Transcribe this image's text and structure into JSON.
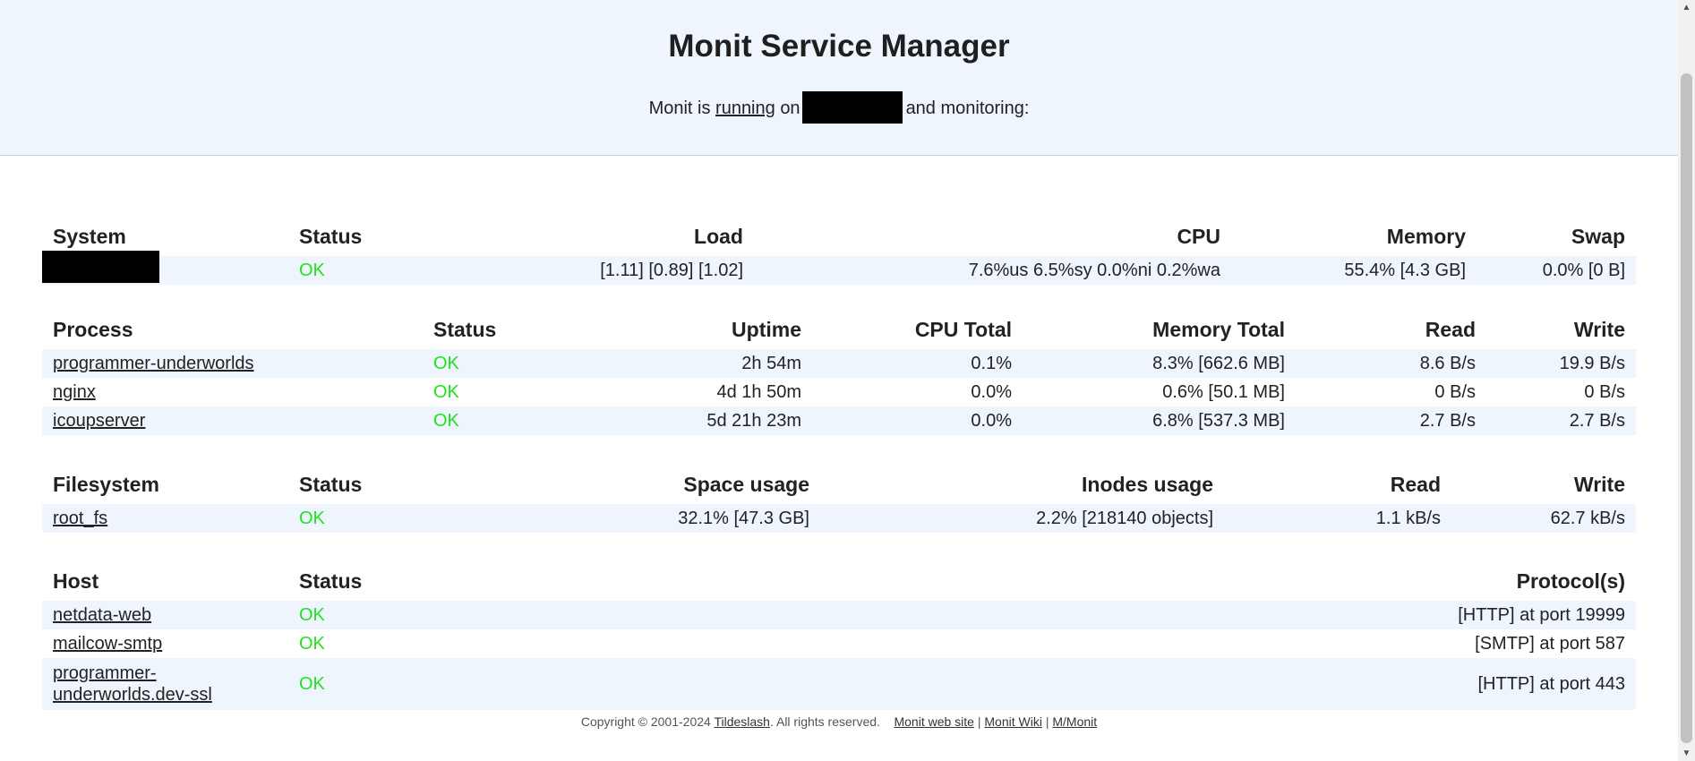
{
  "header": {
    "title": "Monit Service Manager",
    "subtitle_prefix": "Monit is",
    "running_link": "running",
    "on_text": "on",
    "suffix": "and monitoring:"
  },
  "system": {
    "headers": [
      "System",
      "Status",
      "Load",
      "CPU",
      "Memory",
      "Swap"
    ],
    "row": {
      "status": "OK",
      "load": "[1.11] [0.89] [1.02]",
      "cpu": "7.6%us 6.5%sy 0.0%ni 0.2%wa",
      "memory": "55.4% [4.3 GB]",
      "swap": "0.0% [0 B]"
    }
  },
  "process": {
    "headers": [
      "Process",
      "Status",
      "Uptime",
      "CPU Total",
      "Memory Total",
      "Read",
      "Write"
    ],
    "rows": [
      {
        "name": "programmer-underworlds",
        "status": "OK",
        "uptime": "2h 54m",
        "cpu": "0.1%",
        "memory": "8.3% [662.6 MB]",
        "read": "8.6 B/s",
        "write": "19.9 B/s"
      },
      {
        "name": "nginx",
        "status": "OK",
        "uptime": "4d 1h 50m",
        "cpu": "0.0%",
        "memory": "0.6% [50.1 MB]",
        "read": "0 B/s",
        "write": "0 B/s"
      },
      {
        "name": "icoupserver",
        "status": "OK",
        "uptime": "5d 21h 23m",
        "cpu": "0.0%",
        "memory": "6.8% [537.3 MB]",
        "read": "2.7 B/s",
        "write": "2.7 B/s"
      }
    ]
  },
  "filesystem": {
    "headers": [
      "Filesystem",
      "Status",
      "Space usage",
      "Inodes usage",
      "Read",
      "Write"
    ],
    "rows": [
      {
        "name": "root_fs",
        "status": "OK",
        "space": "32.1% [47.3 GB]",
        "inodes": "2.2% [218140 objects]",
        "read": "1.1 kB/s",
        "write": "62.7 kB/s"
      }
    ]
  },
  "host": {
    "headers": [
      "Host",
      "Status",
      "Protocol(s)"
    ],
    "rows": [
      {
        "name": "netdata-web",
        "status": "OK",
        "protocol": "[HTTP] at port 19999"
      },
      {
        "name": "mailcow-smtp",
        "status": "OK",
        "protocol": "[SMTP] at port 587"
      },
      {
        "name": "programmer-underworlds.dev-ssl",
        "status": "OK",
        "protocol": "[HTTP] at port 443"
      }
    ]
  },
  "footer": {
    "copyright": "Copyright © 2001-2024",
    "company_link": "Tildeslash",
    "rights": ". All rights reserved.",
    "links": [
      "Monit web site",
      "Monit Wiki",
      "M/Monit"
    ],
    "separator": "|"
  },
  "colors": {
    "ok": "#22e022",
    "row_alt": "#eef5fd",
    "header_bg": "#eef5fd"
  }
}
